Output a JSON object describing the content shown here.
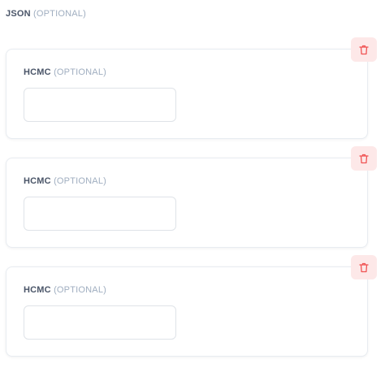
{
  "section": {
    "label": "JSON",
    "optional": "(OPTIONAL)"
  },
  "accent_colors": {
    "delete_bg": "#fde8e8",
    "delete_icon": "#f05252"
  },
  "items": [
    {
      "label": "HCMC",
      "optional": "(OPTIONAL)",
      "value": "",
      "delete_icon": "trash-icon"
    },
    {
      "label": "HCMC",
      "optional": "(OPTIONAL)",
      "value": "",
      "delete_icon": "trash-icon"
    },
    {
      "label": "HCMC",
      "optional": "(OPTIONAL)",
      "value": "",
      "delete_icon": "trash-icon"
    }
  ]
}
